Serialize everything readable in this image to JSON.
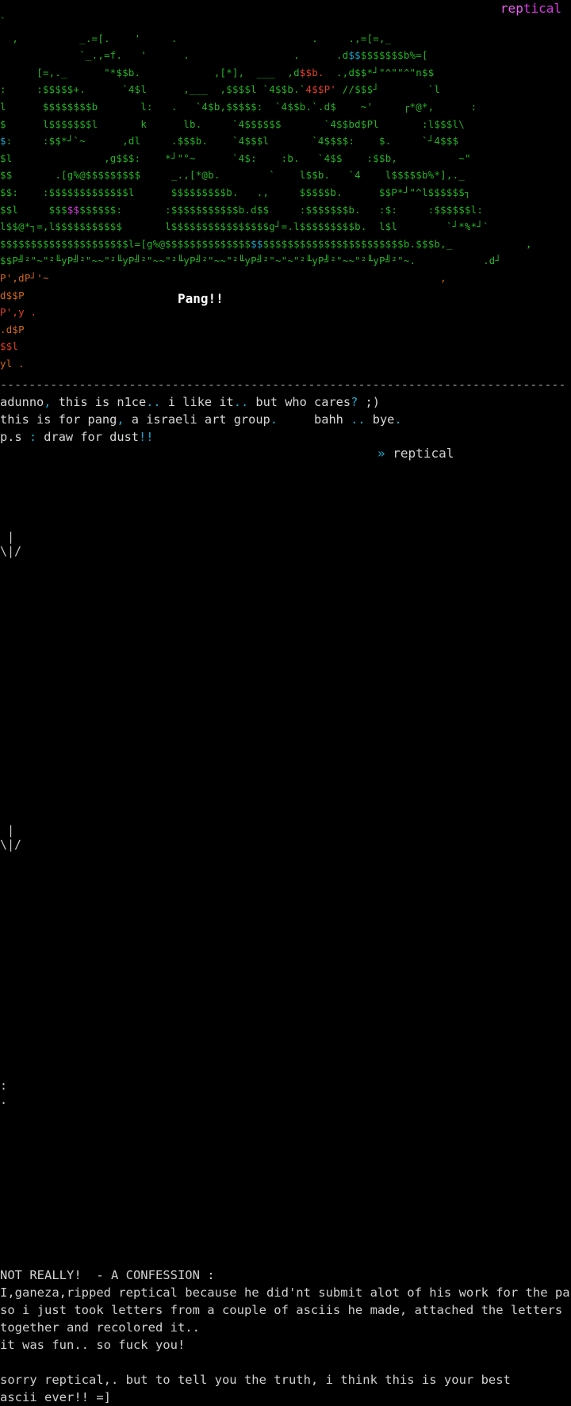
{
  "credit_top": {
    "part1": "rep",
    "part2": "tical"
  },
  "art": {
    "rows": [
      [
        [
          "`                                                                   ",
          "g"
        ]
      ],
      [
        [
          "  ,          _.=[.    '     .                      .     .,=[=,_",
          "g"
        ]
      ],
      [
        [
          "             `_.,=f.   '      .                 .      .d",
          "g"
        ],
        [
          "$$",
          "c"
        ],
        [
          "$$$$$$$b%=[",
          "g"
        ]
      ],
      [
        [
          "      [=,._      \"*$$b.            ,[*],  ___  ,d",
          "g"
        ],
        [
          "$$b.",
          "r"
        ],
        [
          "  .,d$$*┘\"^\"\"^\"n$$",
          "g"
        ]
      ],
      [
        [
          ":     :$$$$$+.      `4$l      ,___  ,$$$$l `4$$b.`",
          "g"
        ],
        [
          "4$$P'",
          "r"
        ],
        [
          " //$$$┘        `l",
          "g"
        ]
      ],
      [
        [
          "l      $$$$$$$$b       l:   .   `4$b,$$$$$:  `4$$b.`.d$    ~'     ┌*@*,      :",
          "g"
        ]
      ],
      [
        [
          "$      l$$$$$$$l       k      lb.     `4$$$$$$       `4$$bd$Pl       :l$$$l\\",
          "g"
        ]
      ],
      [
        [
          "",
          "g"
        ],
        [
          "$",
          "c"
        ],
        [
          ":     :$$*┘`~      ,dl     .$$$b.    `4$$$l       `4$$$$:    $.     `┘4$$$",
          "g"
        ]
      ],
      [
        [
          "$l               ,g$$$:    *┘\"°~      `4$:    :b.   `4$$    :$$b,          ~\"",
          "g"
        ]
      ],
      [
        [
          "$$       .[g%@$$$$$$$$$     _.,[*@b.        `    l$$b.   `4    l$$$$$b%*],._",
          "g"
        ]
      ],
      [
        [
          "$$:    :$$$$$$$$$$$$$l      $$$$$$$$$b.   .,     $$$$$b.      $$P*┘\"^l$$$$$$┐",
          "g"
        ]
      ],
      [
        [
          "$$l     $$$",
          "g"
        ],
        [
          "$$",
          "m"
        ],
        [
          "$$$$$$:       :$$$$$$$$$$$b.d$$     :$$$$$$$b.   :$:     :$$$$$$l:",
          "g"
        ]
      ],
      [
        [
          "l$$@*┐=,l$$$$$$$$$$$       l$$$$$$$$$$$$$$$$g┘=.l$$$$$$$$$b.  l$l        `┘*%*┘`",
          "g"
        ]
      ],
      [
        [
          "$$$$$$$$$$$$$$$$$$$$$l=[g%@$$$$$$$$$$$$$$",
          "g"
        ],
        [
          "$$",
          "c"
        ],
        [
          "$$$$$$$$$$$$$$$$$$$$$$$b.$$$b,_            ,",
          "g"
        ]
      ],
      [
        [
          "$$P╝²\"~\"²╙yP╝²\"~~\"²╙yP╝²\"~~\"²╙yP╝²\"~~\"²╙yP╝²\"~\"~\"²╙yP╝²\"~~\"²╙yP╝²\"~.           .d┘",
          "g"
        ]
      ],
      [
        [
          "P',dP┘'~                                                                ,",
          "o"
        ]
      ],
      [
        [
          "d$$P",
          "o"
        ]
      ],
      [
        [
          "P',y .",
          "r"
        ]
      ],
      [
        [
          ".d$P",
          "o"
        ]
      ],
      [
        [
          "$$l",
          "r"
        ]
      ],
      [
        [
          "yl .",
          "o"
        ]
      ]
    ]
  },
  "pang_label": "Pang!!",
  "rule": "----------------------------------------------------------------------------------",
  "message": {
    "line1": [
      [
        "adunno",
        "w"
      ],
      [
        ",",
        "c"
      ],
      [
        " this is n1ce",
        "w"
      ],
      [
        "..",
        "c"
      ],
      [
        " i like it",
        "w"
      ],
      [
        "..",
        "c"
      ],
      [
        " but who cares",
        "w"
      ],
      [
        "?",
        "c"
      ],
      [
        " ;)",
        "w"
      ]
    ],
    "line2": [
      [
        "this is for pang",
        "w"
      ],
      [
        ",",
        "c"
      ],
      [
        " a israeli art group",
        "w"
      ],
      [
        ".",
        "c"
      ],
      [
        "     bahh ",
        "w"
      ],
      [
        "..",
        "c"
      ],
      [
        " bye",
        "w"
      ],
      [
        ".",
        "c"
      ]
    ],
    "line3": [
      [
        "p.s ",
        "w"
      ],
      [
        ":",
        "c"
      ],
      [
        " draw for dust",
        "w"
      ],
      [
        "!!",
        "c"
      ]
    ],
    "signature_arrows": "»",
    "signature_name": "reptical"
  },
  "marks": {
    "mark1": " |\n\\|/",
    "mark2": " |\n\\|/",
    "mark3": ":\n."
  },
  "confession": {
    "title": "NOT REALLY!  - A CONFESSION :",
    "lines": [
      "I,ganeza,ripped reptical because he did'nt submit alot of his work for the pack",
      "so i just took letters from a couple of asciis he made, attached the letters",
      "together and recolored it..",
      "it was fun.. so fuck you!",
      "",
      "sorry reptical,. but to tell you the truth, i think this is your best",
      "ascii ever!! =]"
    ]
  }
}
